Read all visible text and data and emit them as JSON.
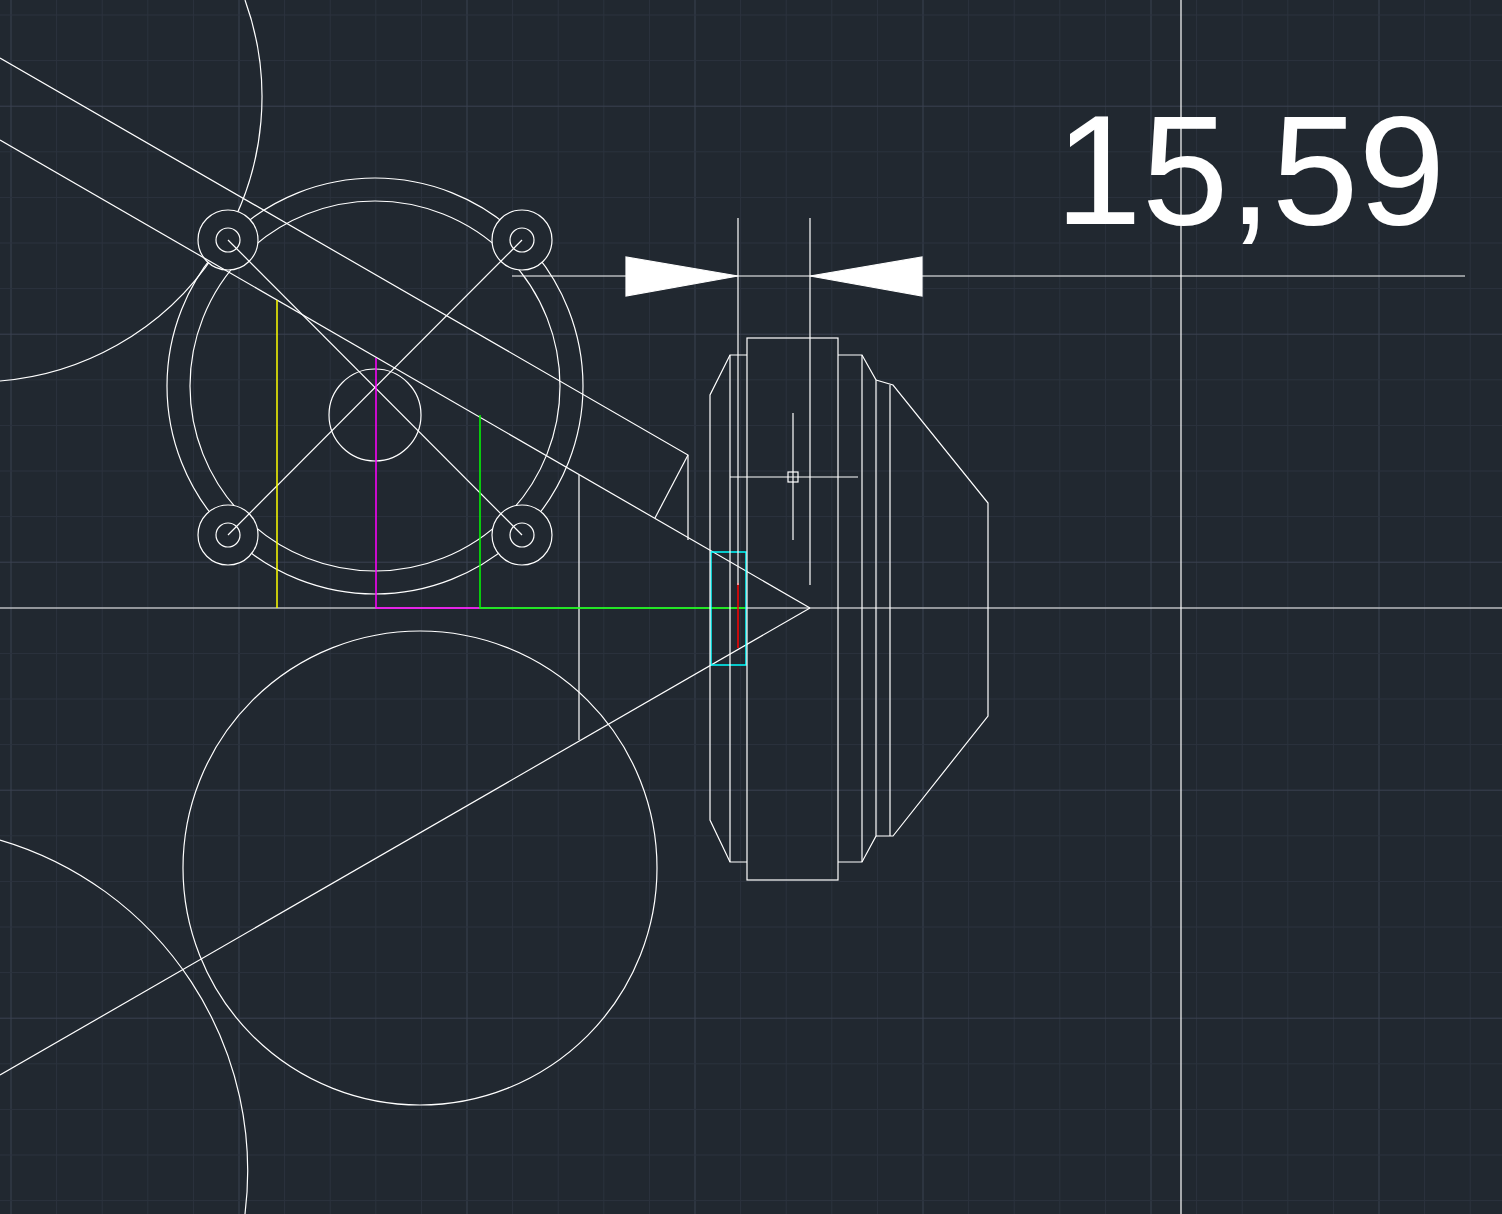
{
  "canvas": {
    "dimension": {
      "value": "15,59"
    }
  }
}
